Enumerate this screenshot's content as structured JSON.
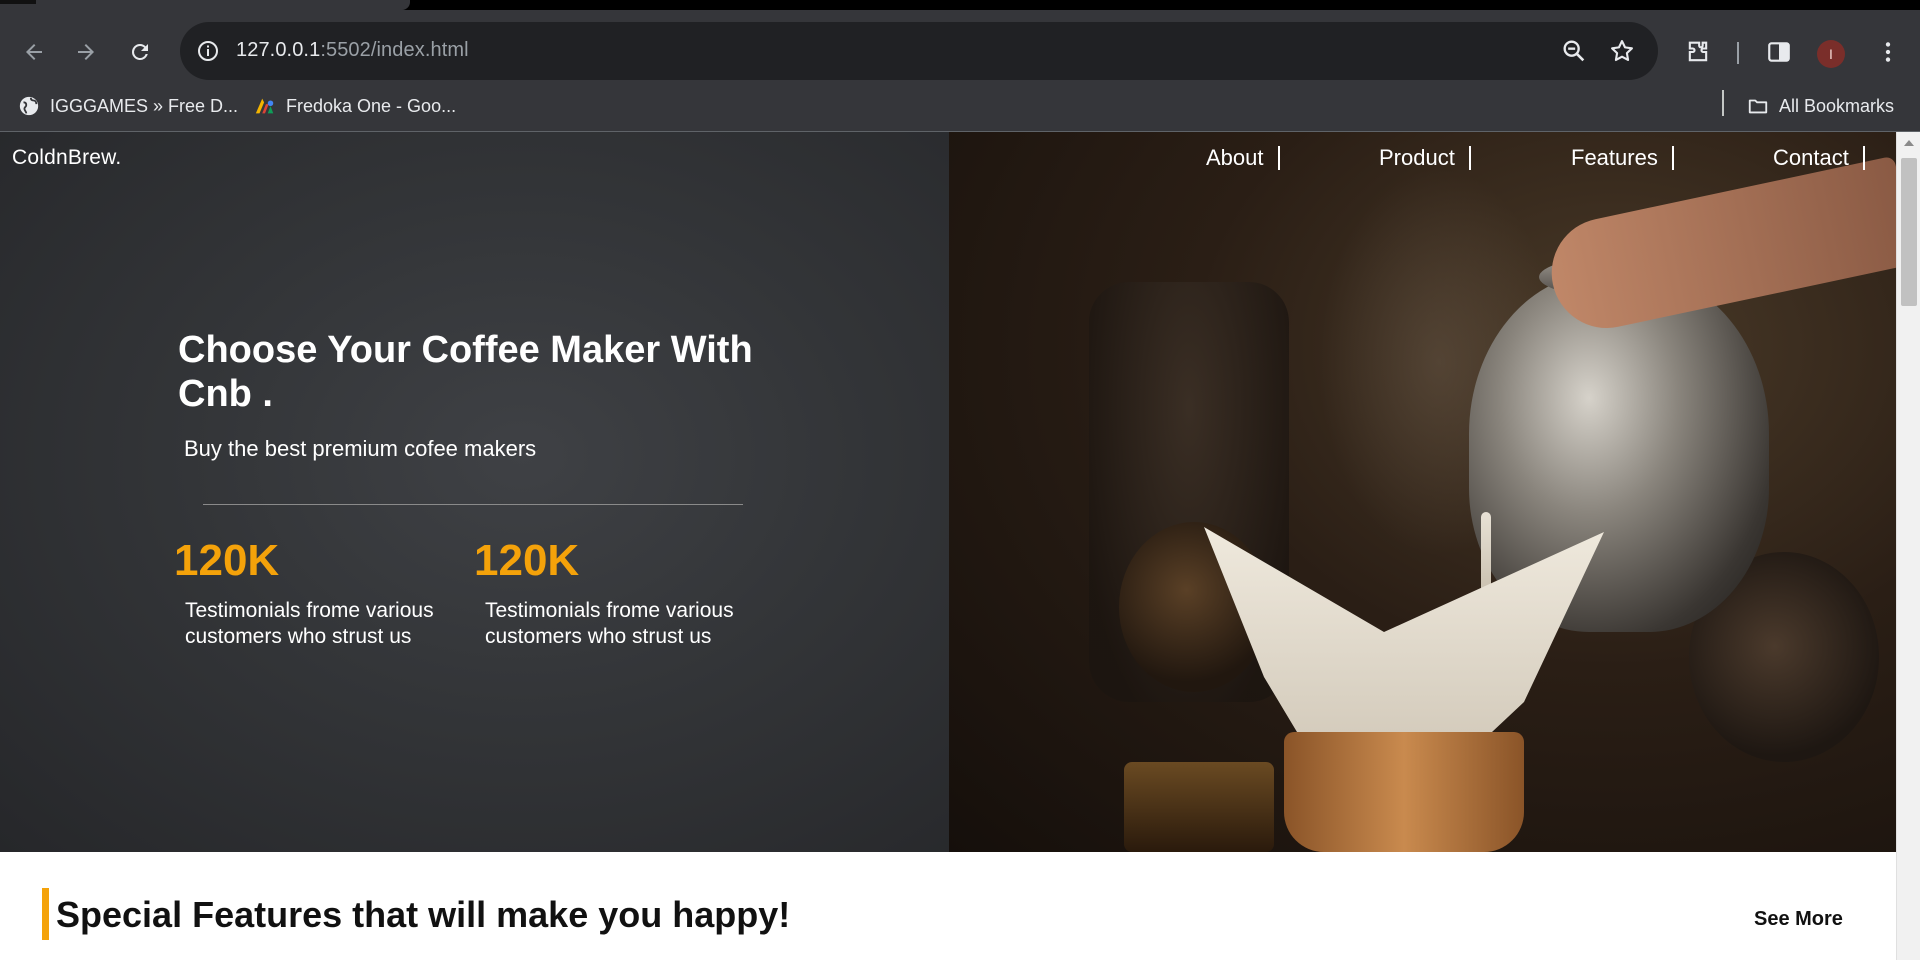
{
  "browser": {
    "url_host": "127.0.0.1",
    "url_rest": ":5502/index.html",
    "avatar_initial": "I",
    "bookmarks": [
      {
        "label": "IGGGAMES » Free D...",
        "icon": "globe-icon"
      },
      {
        "label": "Fredoka One - Goo...",
        "icon": "google-fonts-icon"
      }
    ],
    "all_bookmarks_label": "All Bookmarks"
  },
  "site": {
    "brand": "ColdnBrew.",
    "nav": [
      "About",
      "Product",
      "Features",
      "Contact"
    ]
  },
  "hero": {
    "headline": "Choose Your Coffee Maker With Cnb .",
    "subhead": "Buy the best premium cofee makers",
    "stats": [
      {
        "number": "120K",
        "text": "Testimonials frome various customers who strust us"
      },
      {
        "number": "120K",
        "text": "Testimonials frome various customers who strust us"
      }
    ]
  },
  "features": {
    "title": "Special Features that will make you happy!",
    "see_more": "See More"
  },
  "colors": {
    "accent": "#f4a20a",
    "hero_bg": "#333538"
  }
}
